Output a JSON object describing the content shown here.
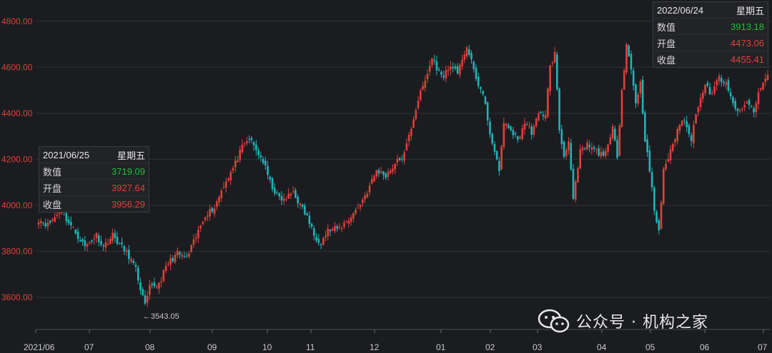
{
  "chart_data": {
    "type": "candlestick",
    "y_ticks": [
      "4800.00",
      "4600.00",
      "4400.00",
      "4200.00",
      "4000.00",
      "3800.00",
      "3600.00"
    ],
    "x_ticks": [
      "2021/06",
      "07",
      "08",
      "09",
      "10",
      "11",
      "12",
      "01",
      "02",
      "03",
      "04",
      "05",
      "06",
      "07"
    ],
    "ylim": [
      3460,
      4880
    ],
    "grid": true,
    "up_color": "#e0413a",
    "down_color": "#1fb5b7",
    "waypoints": [
      [
        0,
        3940
      ],
      [
        4,
        3915
      ],
      [
        8,
        3960
      ],
      [
        10,
        3990
      ],
      [
        12,
        3940
      ],
      [
        16,
        3880
      ],
      [
        20,
        3820
      ],
      [
        25,
        3870
      ],
      [
        28,
        3820
      ],
      [
        32,
        3870
      ],
      [
        35,
        3830
      ],
      [
        39,
        3780
      ],
      [
        42,
        3720
      ],
      [
        46,
        3560
      ],
      [
        48,
        3640
      ],
      [
        52,
        3660
      ],
      [
        56,
        3750
      ],
      [
        60,
        3790
      ],
      [
        64,
        3770
      ],
      [
        68,
        3860
      ],
      [
        72,
        3960
      ],
      [
        76,
        3990
      ],
      [
        80,
        4090
      ],
      [
        84,
        4160
      ],
      [
        88,
        4250
      ],
      [
        91,
        4290
      ],
      [
        94,
        4240
      ],
      [
        97,
        4190
      ],
      [
        100,
        4100
      ],
      [
        103,
        4040
      ],
      [
        106,
        4020
      ],
      [
        110,
        4060
      ],
      [
        113,
        4000
      ],
      [
        116,
        3950
      ],
      [
        119,
        3870
      ],
      [
        122,
        3840
      ],
      [
        125,
        3890
      ],
      [
        130,
        3900
      ],
      [
        134,
        3940
      ],
      [
        138,
        3990
      ],
      [
        142,
        4060
      ],
      [
        146,
        4150
      ],
      [
        150,
        4130
      ],
      [
        154,
        4180
      ],
      [
        158,
        4220
      ],
      [
        162,
        4380
      ],
      [
        164,
        4460
      ],
      [
        167,
        4540
      ],
      [
        170,
        4640
      ],
      [
        172,
        4600
      ],
      [
        174,
        4560
      ],
      [
        176,
        4580
      ],
      [
        179,
        4610
      ],
      [
        181,
        4560
      ],
      [
        183,
        4640
      ],
      [
        185,
        4690
      ],
      [
        187,
        4620
      ],
      [
        189,
        4550
      ],
      [
        192,
        4480
      ],
      [
        195,
        4320
      ],
      [
        197,
        4220
      ],
      [
        199,
        4160
      ],
      [
        201,
        4350
      ],
      [
        204,
        4330
      ],
      [
        207,
        4280
      ],
      [
        210,
        4360
      ],
      [
        213,
        4320
      ],
      [
        216,
        4390
      ],
      [
        219,
        4400
      ],
      [
        221,
        4600
      ],
      [
        223,
        4660
      ],
      [
        225,
        4330
      ],
      [
        227,
        4210
      ],
      [
        229,
        4290
      ],
      [
        231,
        4020
      ],
      [
        234,
        4230
      ],
      [
        237,
        4260
      ],
      [
        240,
        4240
      ],
      [
        243,
        4220
      ],
      [
        246,
        4250
      ],
      [
        248,
        4330
      ],
      [
        250,
        4220
      ],
      [
        252,
        4500
      ],
      [
        254,
        4700
      ],
      [
        256,
        4590
      ],
      [
        258,
        4450
      ],
      [
        260,
        4530
      ],
      [
        262,
        4290
      ],
      [
        264,
        4150
      ],
      [
        266,
        3980
      ],
      [
        268,
        3880
      ],
      [
        270,
        4160
      ],
      [
        273,
        4230
      ],
      [
        276,
        4330
      ],
      [
        279,
        4380
      ],
      [
        282,
        4290
      ],
      [
        285,
        4440
      ],
      [
        288,
        4520
      ],
      [
        291,
        4480
      ],
      [
        294,
        4560
      ],
      [
        297,
        4520
      ],
      [
        300,
        4440
      ],
      [
        303,
        4400
      ],
      [
        306,
        4450
      ],
      [
        309,
        4410
      ],
      [
        312,
        4520
      ],
      [
        315,
        4560
      ]
    ],
    "series": [
      {
        "x_start": "2021/06",
        "x_end": "07",
        "count": 316
      }
    ],
    "annotations": [
      {
        "text": "←3543.05",
        "date": "2021/07 end",
        "value": 3543.05,
        "kind": "low"
      }
    ]
  },
  "tooltips": [
    {
      "date": "2021/06/25",
      "weekday": "星期五",
      "rows": [
        {
          "label": "数值",
          "value": "3719.09",
          "color": "green"
        },
        {
          "label": "开盘",
          "value": "3927.64",
          "color": "red"
        },
        {
          "label": "收盘",
          "value": "3956.29",
          "color": "red"
        }
      ]
    },
    {
      "date": "2022/06/24",
      "weekday": "星期五",
      "rows": [
        {
          "label": "数值",
          "value": "3913.18",
          "color": "green"
        },
        {
          "label": "开盘",
          "value": "4473.06",
          "color": "red"
        },
        {
          "label": "收盘",
          "value": "4455.41",
          "color": "red"
        }
      ]
    }
  ],
  "watermark": {
    "text": "公众号 · 机构之家",
    "icon": "wechat-icon"
  }
}
